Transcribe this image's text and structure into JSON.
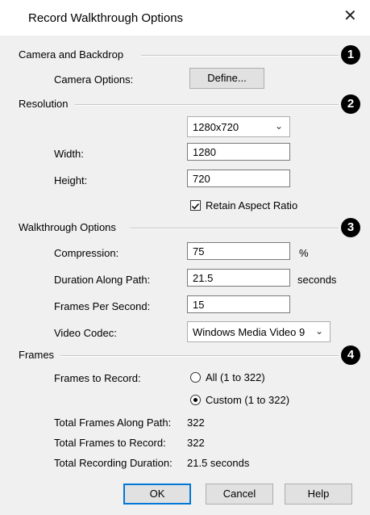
{
  "window": {
    "title": "Record Walkthrough Options",
    "close_glyph": "✕"
  },
  "camera": {
    "group_label": "Camera and Backdrop",
    "marker": "1",
    "camera_options_label": "Camera Options:",
    "define_button": "Define..."
  },
  "resolution": {
    "group_label": "Resolution",
    "marker": "2",
    "preset": "1280x720",
    "width_label": "Width:",
    "width_value": "1280",
    "height_label": "Height:",
    "height_value": "720",
    "retain_label": "Retain Aspect Ratio",
    "retain_checked": true
  },
  "walkthrough": {
    "group_label": "Walkthrough Options",
    "marker": "3",
    "compression_label": "Compression:",
    "compression_value": "75",
    "compression_unit": "%",
    "duration_label": "Duration Along Path:",
    "duration_value": "21.5",
    "duration_unit": "seconds",
    "fps_label": "Frames Per Second:",
    "fps_value": "15",
    "codec_label": "Video Codec:",
    "codec_value": "Windows Media Video 9"
  },
  "frames": {
    "group_label": "Frames",
    "marker": "4",
    "to_record_label": "Frames to Record:",
    "option_all": "All (1 to 322)",
    "option_custom": "Custom (1 to 322)",
    "selected": "custom",
    "total_along_label": "Total Frames Along Path:",
    "total_along_value": "322",
    "total_record_label": "Total Frames to Record:",
    "total_record_value": "322",
    "duration_label": "Total Recording Duration:",
    "duration_value": "21.5 seconds"
  },
  "buttons": {
    "ok": "OK",
    "cancel": "Cancel",
    "help": "Help"
  }
}
